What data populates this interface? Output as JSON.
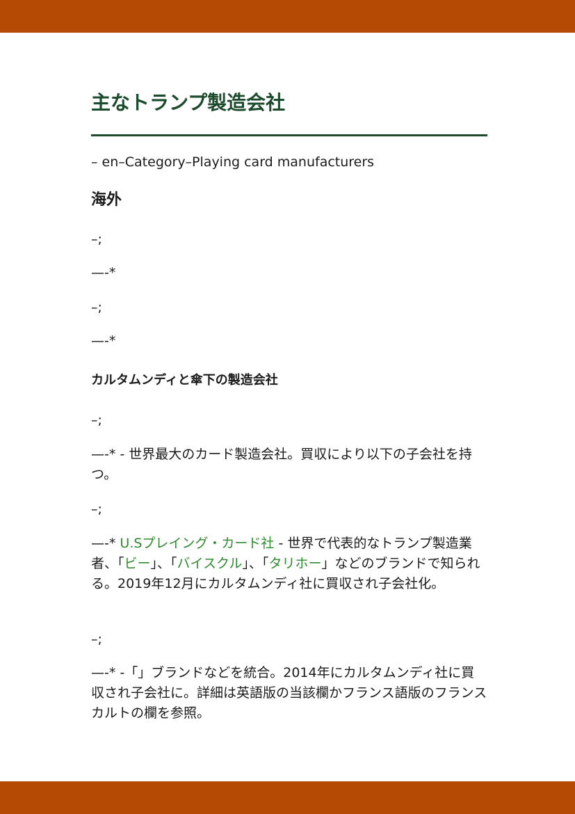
{
  "colors": {
    "band": "#b54a05",
    "title": "#1c4a2c",
    "link": "#2e8a2e"
  },
  "title": "主なトランプ製造会社",
  "category_line": "– en–Category–Playing card manufacturers",
  "section_overseas": {
    "heading": "海外",
    "lines": [
      "–;",
      "—-*",
      "–;",
      "—-*"
    ]
  },
  "section_cartamundi": {
    "heading": "カルタムンディと傘下の製造会社",
    "item1_marker": "–;",
    "item1_text": "—-* - 世界最大のカード製造会社。買収により以下の子会社を持つ。",
    "item2_marker": "–;",
    "item2": {
      "prefix": "—-* ",
      "link_company": "U.Sプレイング・カード社",
      "text1": " - 世界で代表的なトランプ製造業者、「",
      "link_bee": "ビー",
      "text2": "」、「",
      "link_bicycle": "バイスクル",
      "text3": "」、「",
      "link_tally_ho": "タリホー",
      "text4": "」などのブランドで知られる。2019年12月にカルタムンディ社に買収され子会社化。"
    },
    "item3_marker": "–;",
    "item3_text": "—-* -「」ブランドなどを統合。2014年にカルタムンディ社に買収され子会社に。詳細は英語版の当該欄かフランス語版のフランスカルトの欄を参照。"
  }
}
